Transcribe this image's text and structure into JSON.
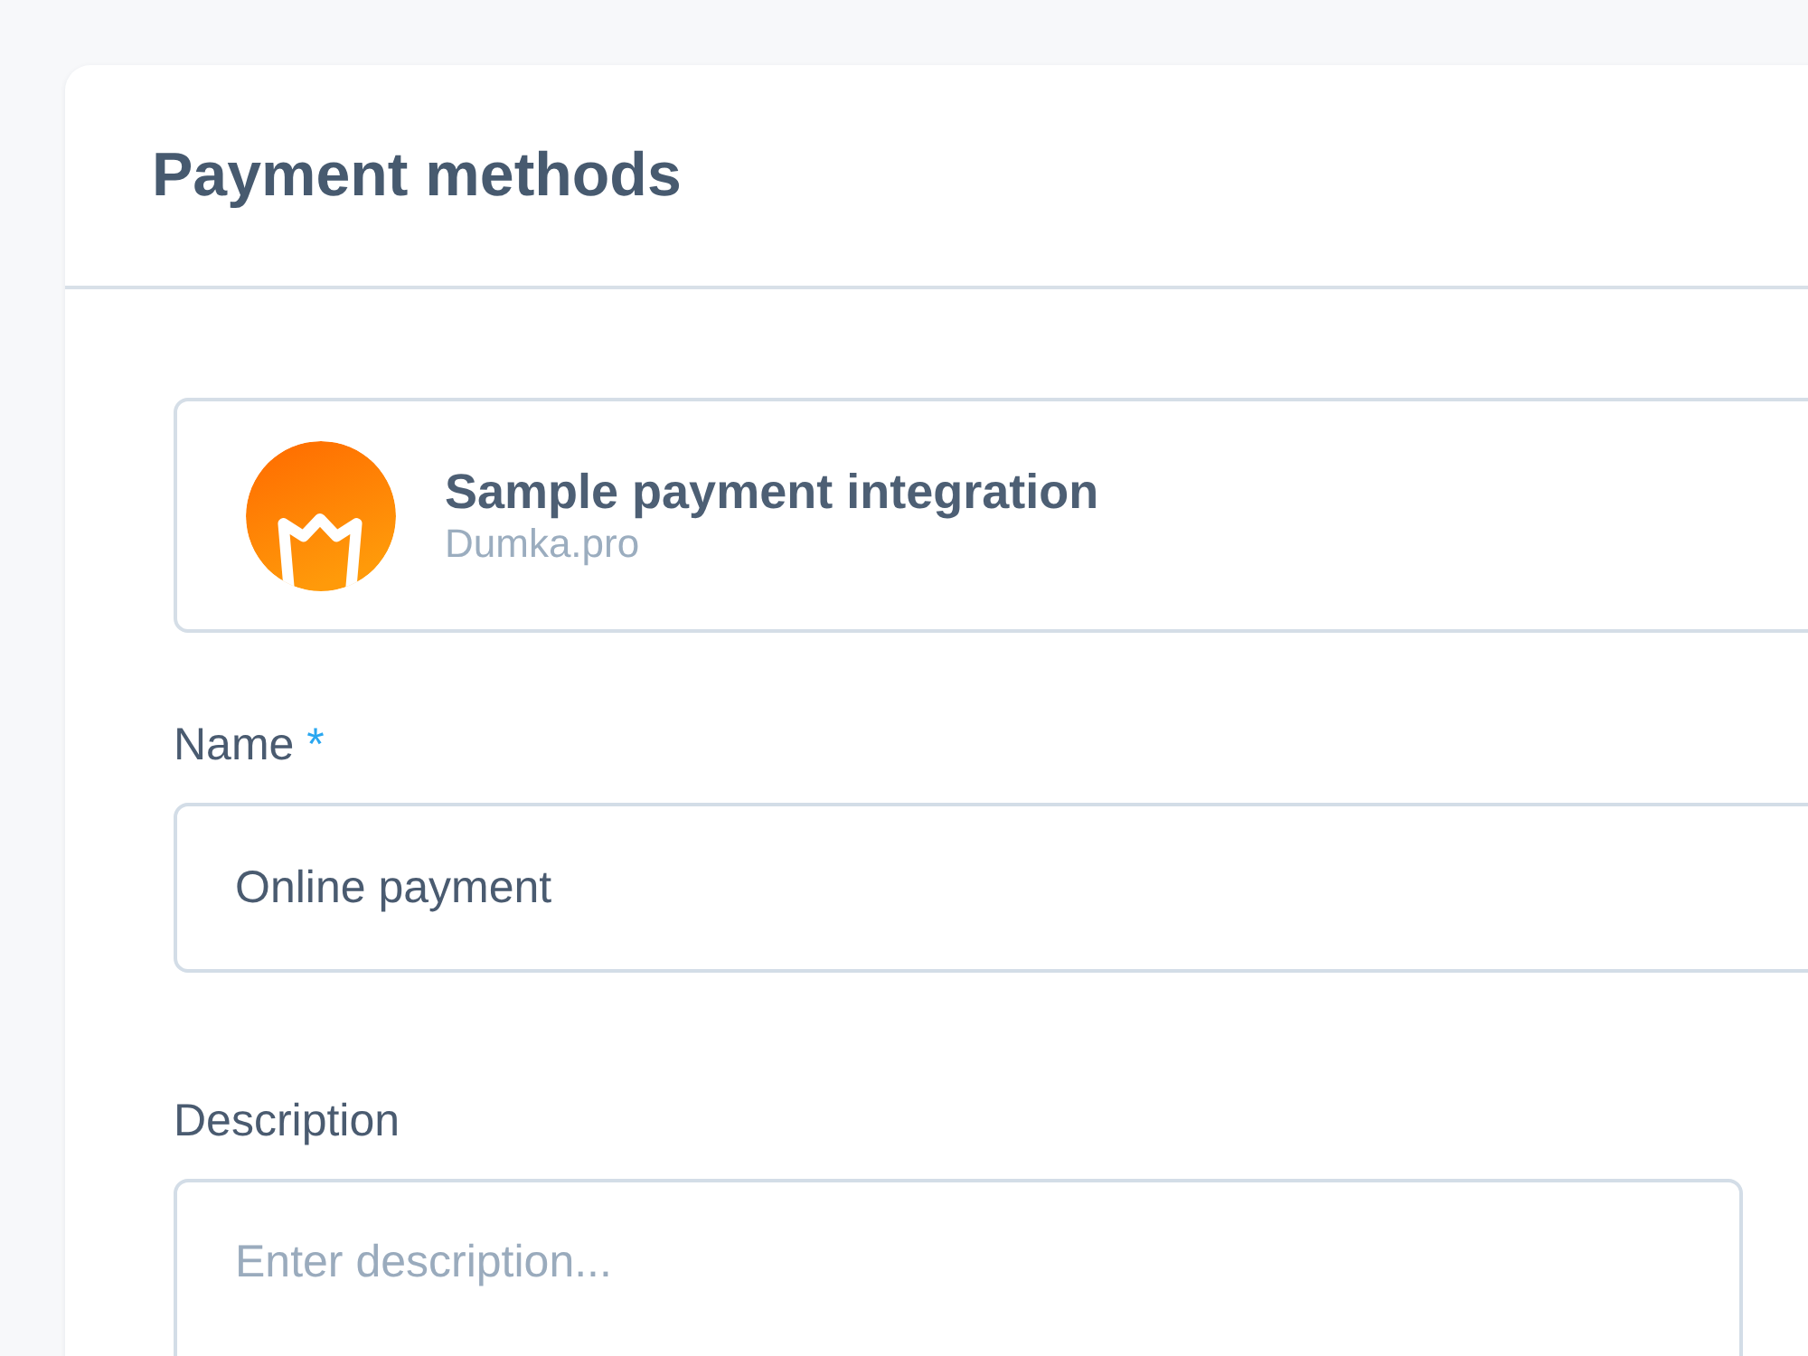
{
  "page": {
    "title": "Payment methods"
  },
  "provider": {
    "name": "Sample payment integration",
    "vendor": "Dumka.pro"
  },
  "fields": [
    {
      "kind": "input",
      "label": "Name",
      "required_mark": "*",
      "value": "Online payment"
    },
    {
      "kind": "textarea",
      "label": "Description",
      "placeholder": "Enter description..."
    }
  ]
}
